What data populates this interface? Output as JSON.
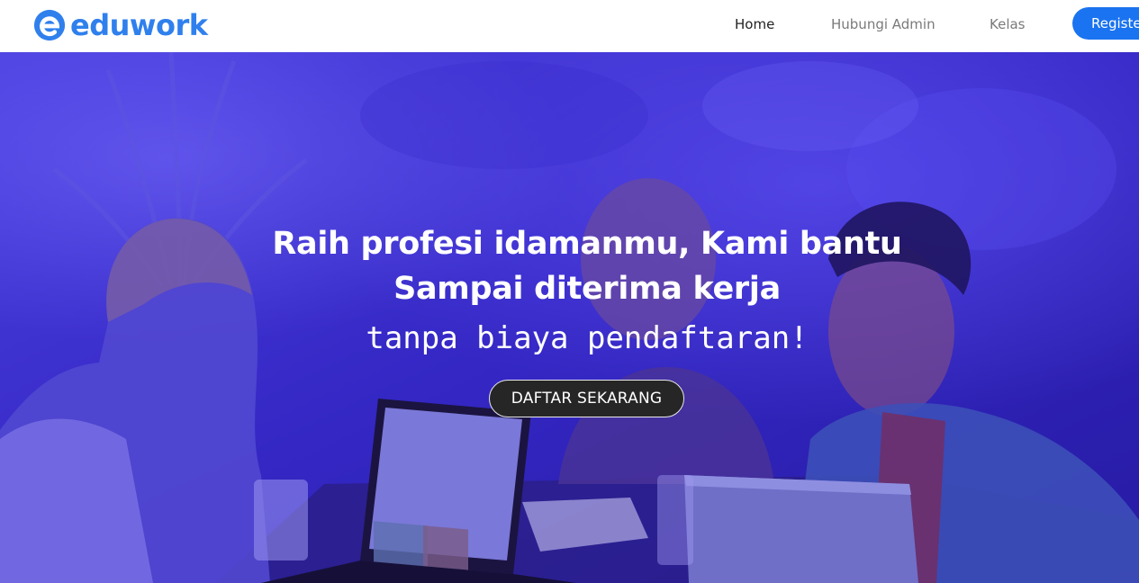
{
  "brand": {
    "name": "eduwork",
    "color": "#2f80ed"
  },
  "nav": {
    "home": "Home",
    "admin": "Hubungi Admin",
    "kelas": "Kelas",
    "register": "Register"
  },
  "hero": {
    "title_line1": "Raih profesi idamanmu, Kami bantu",
    "title_line2": "Sampai diterima kerja",
    "subtitle": "tanpa biaya pendaftaran!",
    "cta": "DAFTAR SEKARANG",
    "overlay_color": "#3b2fd6"
  },
  "colors": {
    "primary": "#1a73f0",
    "cta_bg": "#262626"
  }
}
